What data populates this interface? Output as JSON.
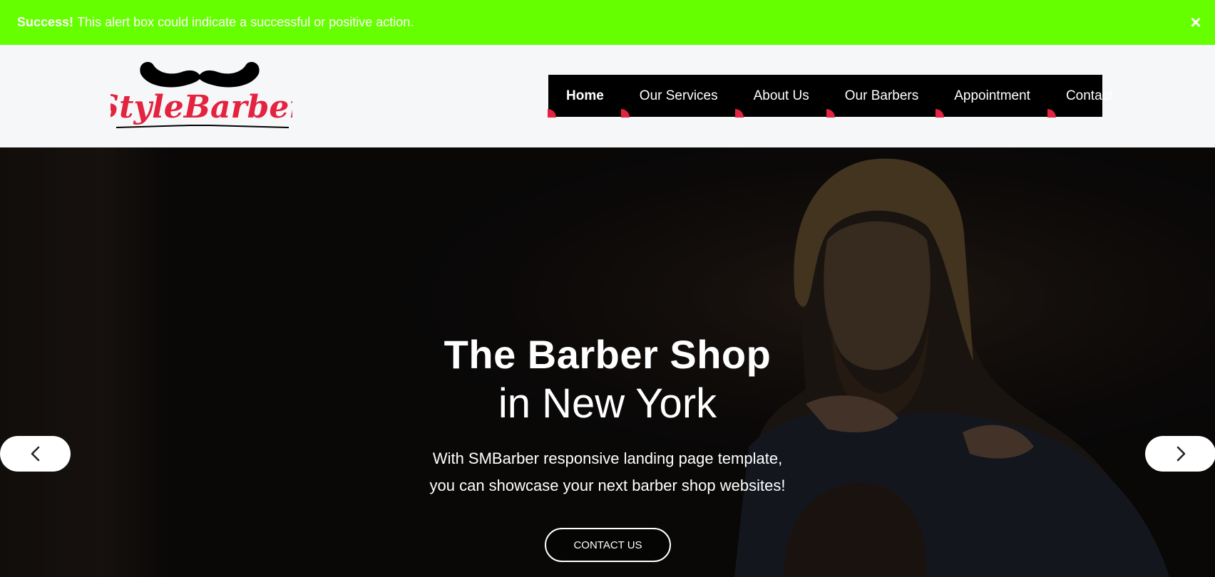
{
  "alert": {
    "title": "Success!",
    "message": "This alert box could indicate a successful or positive action.",
    "close_glyph": "×",
    "background_color": "#66ff00"
  },
  "logo": {
    "text": "StyleBarber",
    "icon": "mustache-icon",
    "color": "#e3233f"
  },
  "nav": {
    "items": [
      {
        "label": "Home",
        "active": true
      },
      {
        "label": "Our Services",
        "active": false
      },
      {
        "label": "About Us",
        "active": false
      },
      {
        "label": "Our Barbers",
        "active": false
      },
      {
        "label": "Appointment",
        "active": false
      },
      {
        "label": "Contact",
        "active": false
      }
    ],
    "accent_color": "#e3233f"
  },
  "hero": {
    "title_line1": "The Barber Shop",
    "title_line2": "in New York",
    "text_line1": "With SMBarber responsive landing page template,",
    "text_line2": "you can showcase your next barber shop websites!",
    "button_label": "CONTACT US",
    "prev_icon": "chevron-left-icon",
    "next_icon": "chevron-right-icon"
  }
}
